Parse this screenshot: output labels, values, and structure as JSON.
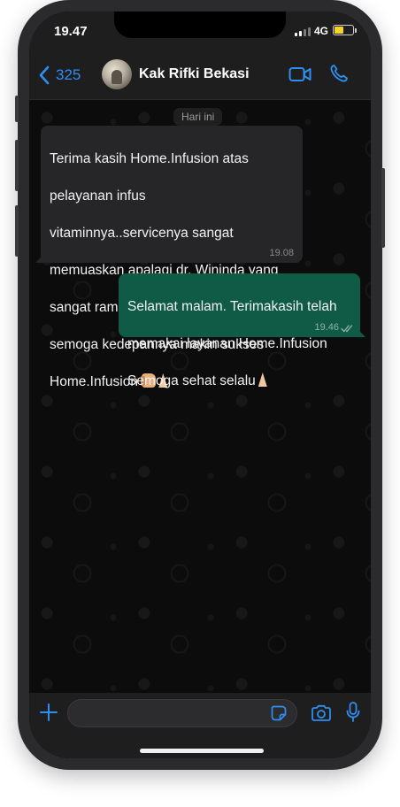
{
  "status_bar": {
    "time": "19.47",
    "network": "4G",
    "battery_level": 0.45,
    "battery_color": "#f5d32a"
  },
  "header": {
    "back_count": "325",
    "contact_name": "Kak Rifki Bekasi",
    "back_icon": "chevron-left-icon",
    "video_icon": "video-camera-icon",
    "call_icon": "phone-icon",
    "accent_color": "#2f8ef4"
  },
  "chat": {
    "date_label": "Hari ini",
    "messages": [
      {
        "direction": "incoming",
        "lines": [
          "Terima kasih Home.Infusion atas",
          "pelayanan infus",
          "vitaminnya..servicenya sangat",
          "memuaskan apalagi dr. Wininda yang",
          "sangat ramah terhadap pasien",
          "semoga kedepannya makin sukses",
          "Home.Infusion"
        ],
        "emojis": [
          "smiling-face-emoji",
          "thumbs-up-emoji",
          "folded-hands-emoji"
        ],
        "time": "19.08",
        "bubble_color": "#262628"
      },
      {
        "direction": "outgoing",
        "lines": [
          "Selamat malam. Terimakasih telah",
          "memakai layanan Home.Infusion",
          "Semoga sehat selalu"
        ],
        "emojis": [
          "folded-hands-emoji"
        ],
        "time": "19.46",
        "status": "read-ticks-icon",
        "bubble_color": "#0f5b46"
      }
    ]
  },
  "input_bar": {
    "message_value": "",
    "plus_icon": "plus-icon",
    "sticker_icon": "sticker-icon",
    "camera_icon": "camera-icon",
    "mic_icon": "microphone-icon"
  }
}
